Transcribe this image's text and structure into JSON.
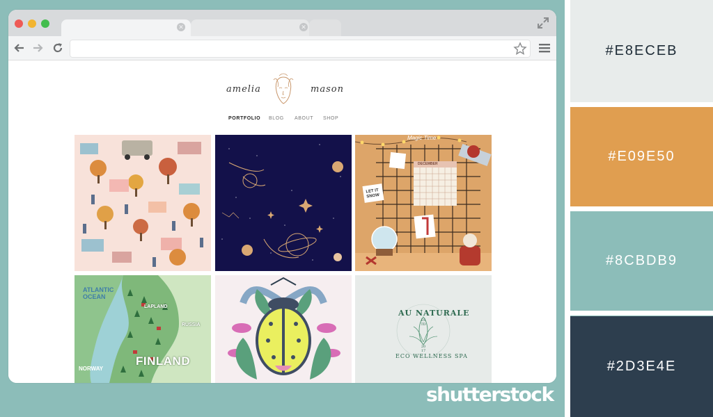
{
  "website": {
    "logo_first": "amelia",
    "logo_last": "mason",
    "nav": [
      "PORTFOLIO",
      "BLOG",
      "ABOUT",
      "SHOP"
    ]
  },
  "tiles": {
    "calendar_title": "Magic Time",
    "calendar_month": "DECEMBER",
    "calendar_day": "1",
    "snow_card": "LET IT SNOW",
    "map_ocean": "ATLANTIC OCEAN",
    "map_lapland": "LAPLAND",
    "map_russia": "RUSSIA",
    "map_country": "FINLAND",
    "map_norway": "NORWAY",
    "spa_top": "AU NATURALE",
    "spa_est": "ES TD",
    "spa_year": "20 17",
    "spa_bottom": "ECO WELLNESS SPA"
  },
  "brand": "shutterstock",
  "palette": [
    {
      "label": "#E8ECEB",
      "color": "#E8ECEB",
      "text_color": "#1d2b36"
    },
    {
      "label": "#E09E50",
      "color": "#E09E50",
      "text_color": "#ffffff"
    },
    {
      "label": "#8CBDB9",
      "color": "#8CBDB9",
      "text_color": "#ffffff"
    },
    {
      "label": "#2D3E4E",
      "color": "#2D3E4E",
      "text_color": "#ffffff"
    }
  ]
}
